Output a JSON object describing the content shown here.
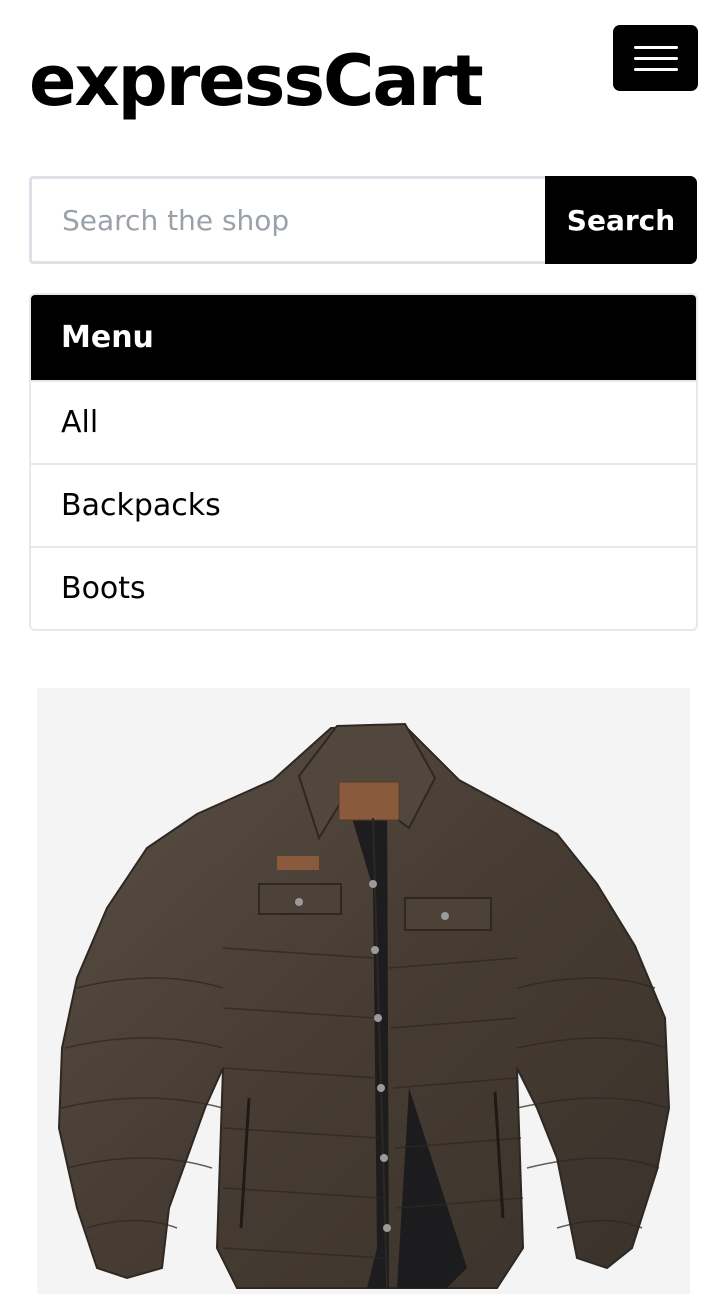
{
  "header": {
    "brand": "expressCart",
    "menu_toggle_icon": "hamburger-menu-icon"
  },
  "search": {
    "placeholder": "Search the shop",
    "value": "",
    "button_label": "Search"
  },
  "menu": {
    "title": "Menu",
    "items": [
      {
        "label": "All"
      },
      {
        "label": "Backpacks"
      },
      {
        "label": "Boots"
      }
    ]
  },
  "product": {
    "image": "brown-quilted-jacket-image"
  },
  "colors": {
    "primary": "#000000",
    "background": "#ffffff",
    "border": "#e8e8e8",
    "input_border": "#dee2e8",
    "placeholder": "#9aa1a8",
    "product_bg": "#f4f4f4",
    "jacket": "#4a4036"
  }
}
